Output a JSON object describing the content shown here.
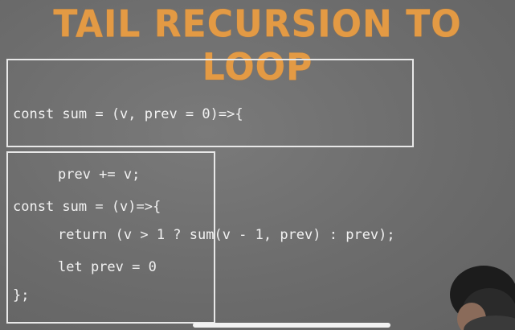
{
  "slide": {
    "title": "TAIL RECURSION TO LOOP",
    "code_top": {
      "lines": [
        "const sum = (v, prev = 0)=>{",
        "prev += v;",
        "return (v > 1 ? sum(v - 1, prev) : prev);",
        "};"
      ]
    },
    "code_bottom": {
      "lines": [
        "const sum = (v)=>{",
        "let prev = 0"
      ]
    }
  },
  "colors": {
    "title": "#e39a44",
    "background": "#6f6f6f",
    "code_text": "#f2f2f2",
    "box_border": "#e8e8e8"
  },
  "icons": {
    "presenter": "person-head-silhouette"
  }
}
